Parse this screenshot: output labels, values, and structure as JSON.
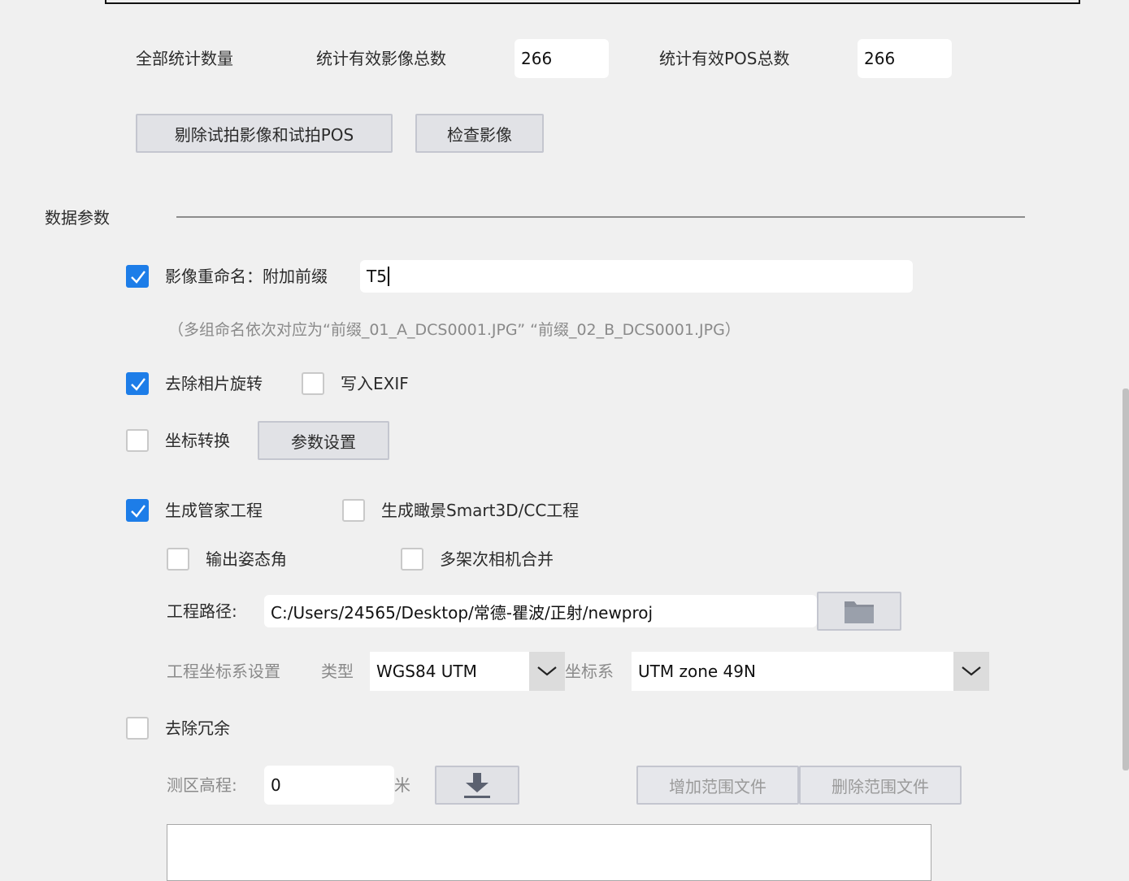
{
  "stats": {
    "all_label": "全部统计数量",
    "images_label": "统计有效影像总数",
    "images_value": "266",
    "pos_label": "统计有效POS总数",
    "pos_value": "266"
  },
  "actions": {
    "remove_test_label": "剔除试拍影像和试拍POS",
    "check_images_label": "检查影像"
  },
  "section": {
    "title": "数据参数"
  },
  "rename": {
    "checked": true,
    "label": "影像重命名：附加前缀",
    "value": "T5",
    "hint": "（多组命名依次对应为“前缀_01_A_DCS0001.JPG” “前缀_02_B_DCS0001.JPG）"
  },
  "rotate": {
    "checked": true,
    "label": "去除相片旋转"
  },
  "exif": {
    "checked": false,
    "label": "写入EXIF"
  },
  "coord": {
    "checked": false,
    "label": "坐标转换",
    "settings_label": "参数设置"
  },
  "project": {
    "manager_checked": true,
    "manager_label": "生成管家工程",
    "smart3d_checked": false,
    "smart3d_label": "生成瞰景Smart3D/CC工程",
    "attitude_checked": false,
    "attitude_label": "输出姿态角",
    "merge_checked": false,
    "merge_label": "多架次相机合并",
    "path_label": "工程路径:",
    "path_value": "C:/Users/24565/Desktop/常德-瞿波/正射/newproj",
    "crs_label": "工程坐标系设置",
    "type_label": "类型",
    "type_value": "WGS84 UTM",
    "crs_sys_label": "坐标系",
    "crs_sys_value": "UTM zone 49N"
  },
  "redundancy": {
    "checked": false,
    "label": "去除冗余",
    "elevation_label": "测区高程:",
    "elevation_value": "0",
    "unit": "米",
    "add_range_label": "增加范围文件",
    "remove_range_label": "删除范围文件"
  }
}
